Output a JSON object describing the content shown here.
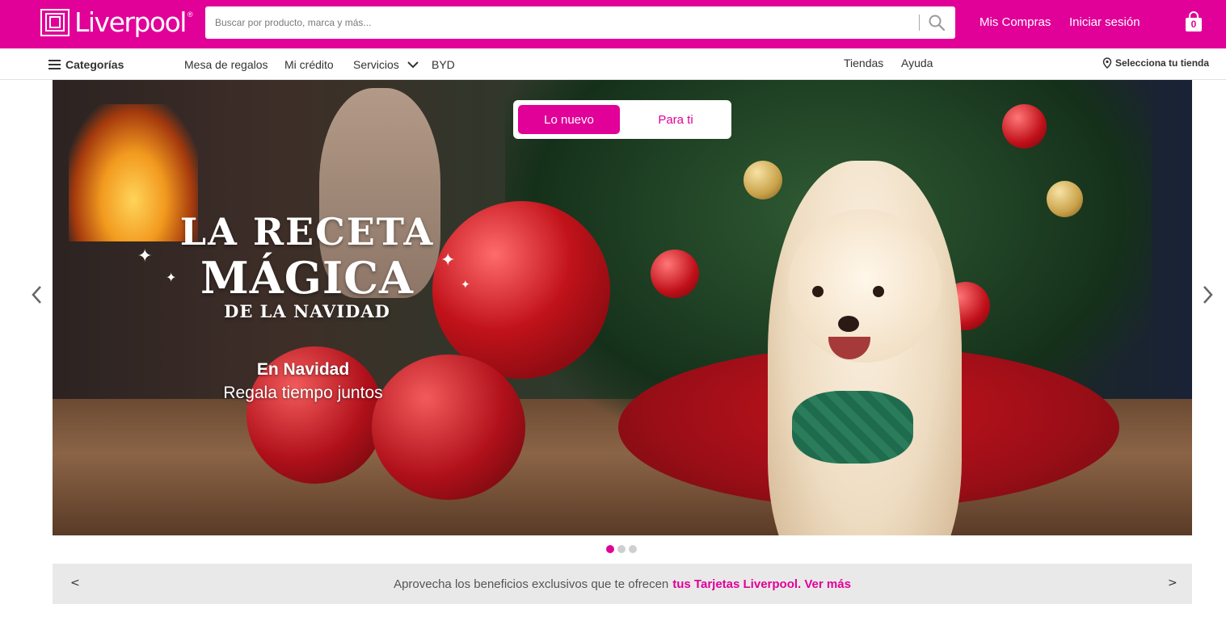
{
  "brand": {
    "name": "Liverpool",
    "registered_mark": "®",
    "color": "#e10098"
  },
  "header": {
    "search_placeholder": "Buscar por producto, marca y más...",
    "my_purchases": "Mis Compras",
    "sign_in": "Iniciar sesión",
    "cart_count": "0"
  },
  "nav": {
    "categories": "Categorías",
    "items": [
      "Mesa de regalos",
      "Mi crédito",
      "Servicios",
      "BYD"
    ],
    "right_items": [
      "Tiendas",
      "Ayuda"
    ],
    "store_selector": "Selecciona tu tienda"
  },
  "hero": {
    "toggle": [
      "Lo nuevo",
      "Para ti"
    ],
    "title_line1": "LA RECETA",
    "title_line2": "MÁGICA",
    "title_line3": "DE LA NAVIDAD",
    "subtitle_bold": "En Navidad",
    "subtitle": "Regala tiempo juntos",
    "slide_count": 3,
    "active_slide": 1
  },
  "promo": {
    "text": "Aprovecha los beneficios exclusivos que te ofrecen",
    "link_text": "tus Tarjetas Liverpool. Ver más",
    "prev": "<",
    "next": ">"
  }
}
